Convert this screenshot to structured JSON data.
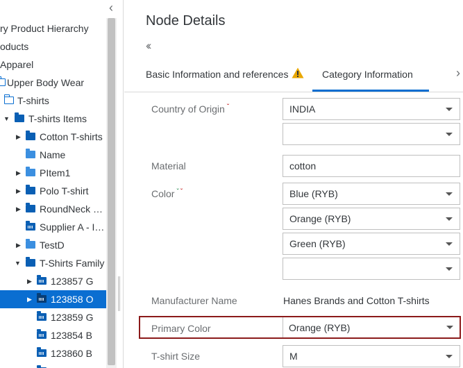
{
  "tree": {
    "collapse_icon": "chevron-left-icon",
    "rows": [
      {
        "label": "ry Product Hierarchy"
      },
      {
        "label": "oducts"
      },
      {
        "label": "Apparel"
      },
      {
        "label": "Upper Body Wear"
      },
      {
        "label": "T-shirts"
      },
      {
        "label": "T-shirts Items"
      },
      {
        "label": "Cotton T-shirts"
      },
      {
        "label": "Name"
      },
      {
        "label": "PItem1"
      },
      {
        "label": "Polo T-shirt"
      },
      {
        "label": "RoundNeck …"
      },
      {
        "label": "Supplier A - I…"
      },
      {
        "label": "TestD"
      },
      {
        "label": "T-Shirts Family"
      },
      {
        "label": "123857 G"
      },
      {
        "label": "123858 O"
      },
      {
        "label": "123859 G"
      },
      {
        "label": "123854 B"
      },
      {
        "label": "123860 B"
      }
    ]
  },
  "detail": {
    "title": "Node Details",
    "back_icon": "double-chevron-left-icon",
    "tabs": [
      {
        "label": "Basic Information and references",
        "warning_icon": "warning-triangle-icon",
        "active": false
      },
      {
        "label": "Category Information",
        "active": true
      }
    ],
    "more_icon": "chevron-right-icon",
    "fields": {
      "country_of_origin": {
        "label": "Country of Origin",
        "values": [
          "INDIA",
          ""
        ]
      },
      "material": {
        "label": "Material",
        "value": "cotton"
      },
      "color": {
        "label": "Color",
        "values": [
          "Blue (RYB)",
          "Orange (RYB)",
          "Green (RYB)",
          ""
        ]
      },
      "manufacturer_name": {
        "label": "Manufacturer Name",
        "value": "Hanes Brands and Cotton T-shirts"
      },
      "primary_color": {
        "label": "Primary Color",
        "value": "Orange (RYB)"
      },
      "tshirt_size": {
        "label": "T-shirt Size",
        "value": "M"
      }
    }
  },
  "colors": {
    "accent": "#0a6ed1",
    "selected_row": "#0a6ed1",
    "highlight_border": "#8b1a1a",
    "warning": "#e9a700"
  }
}
